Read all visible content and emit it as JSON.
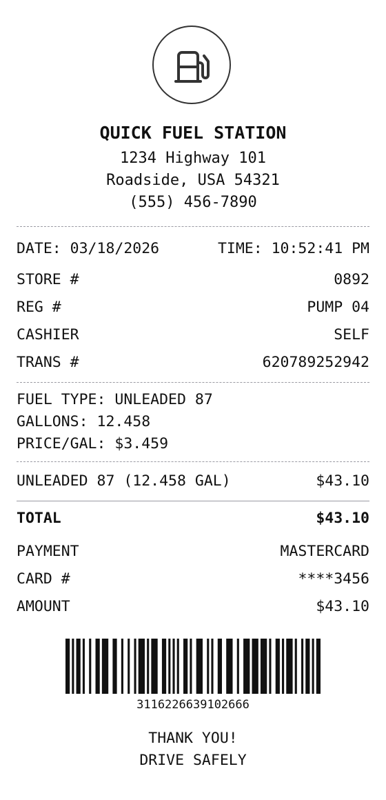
{
  "logo": {
    "icon": "fuel-pump-icon"
  },
  "station": {
    "name": "QUICK FUEL STATION",
    "address1": "1234 Highway 101",
    "address2": "Roadside, USA 54321",
    "phone": "(555) 456-7890"
  },
  "meta": {
    "date": "DATE: 03/18/2026",
    "time": "TIME: 10:52:41 PM",
    "store_label": "STORE #",
    "store_value": "0892",
    "reg_label": "REG #",
    "reg_value": "PUMP 04",
    "cashier_label": "CASHIER",
    "cashier_value": "SELF",
    "trans_label": "TRANS #",
    "trans_value": "620789252942"
  },
  "fuel": {
    "type": "FUEL TYPE: UNLEADED 87",
    "gallons": "GALLONS: 12.458",
    "price": "PRICE/GAL: $3.459"
  },
  "items": [
    {
      "desc": "UNLEADED 87 (12.458 GAL)",
      "amount": "$43.10"
    }
  ],
  "total": {
    "label": "TOTAL",
    "value": "$43.10"
  },
  "payment": {
    "method_label": "PAYMENT",
    "method_value": "MASTERCARD",
    "card_label": "CARD #",
    "card_value": "****3456",
    "amount_label": "AMOUNT",
    "amount_value": "$43.10"
  },
  "barcode": {
    "number": "3116226639102666"
  },
  "footer": {
    "line1": "THANK YOU!",
    "line2": "DRIVE SAFELY"
  }
}
